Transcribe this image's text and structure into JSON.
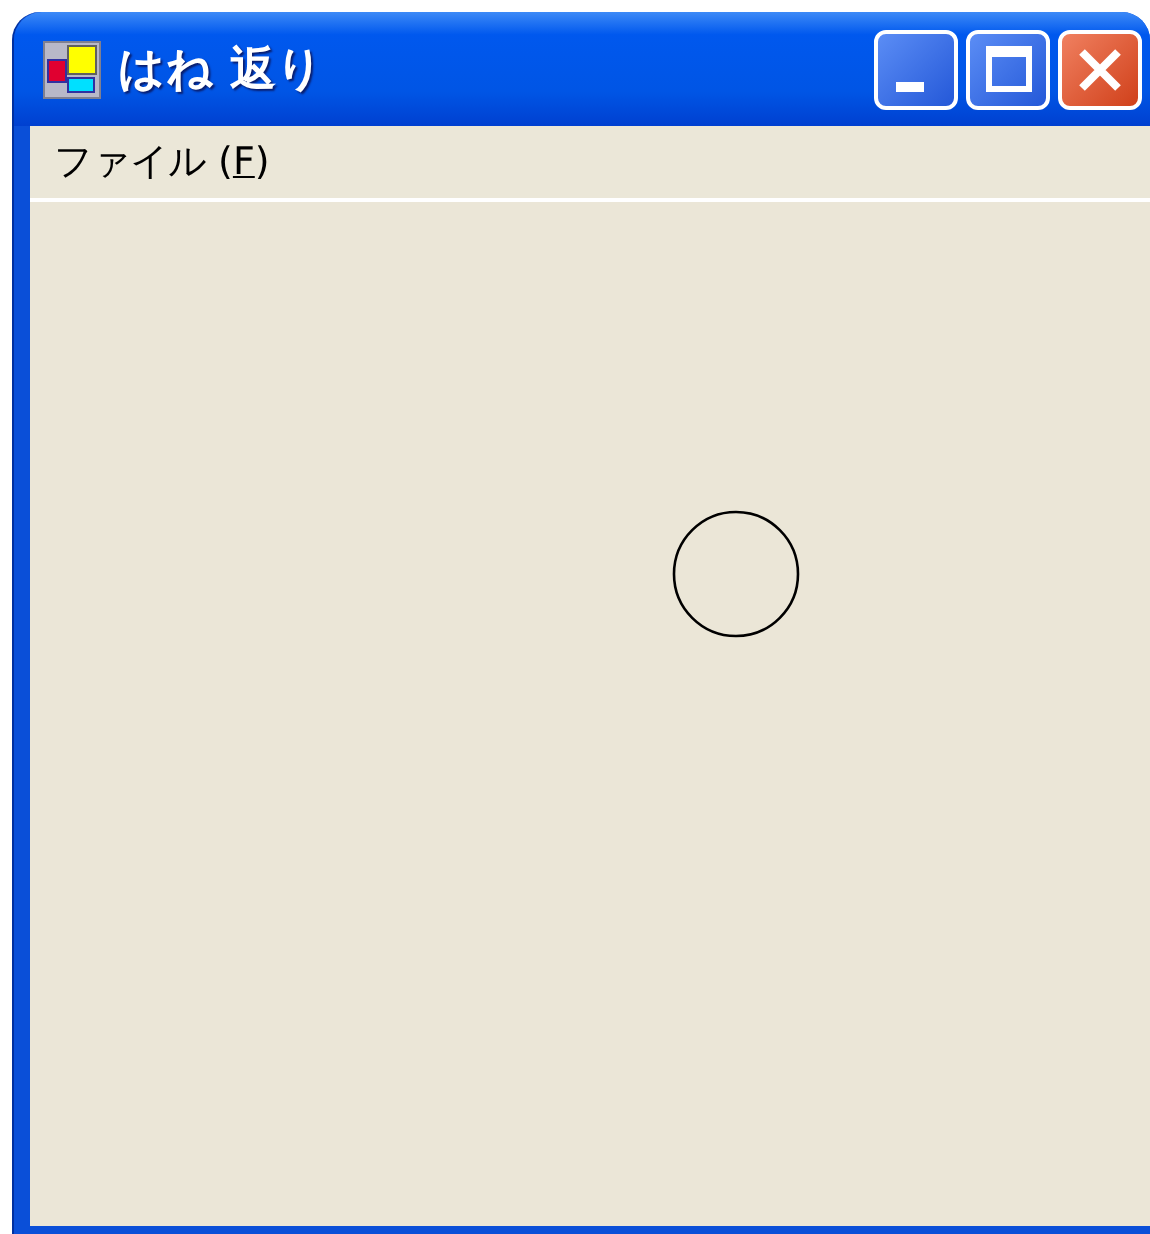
{
  "window": {
    "title": "はね 返り"
  },
  "menu": [
    {
      "text_before": "ファイル (",
      "access_key": "F",
      "text_after": ")"
    }
  ],
  "canvas": {
    "shapes": [
      {
        "kind": "circle"
      }
    ]
  }
}
